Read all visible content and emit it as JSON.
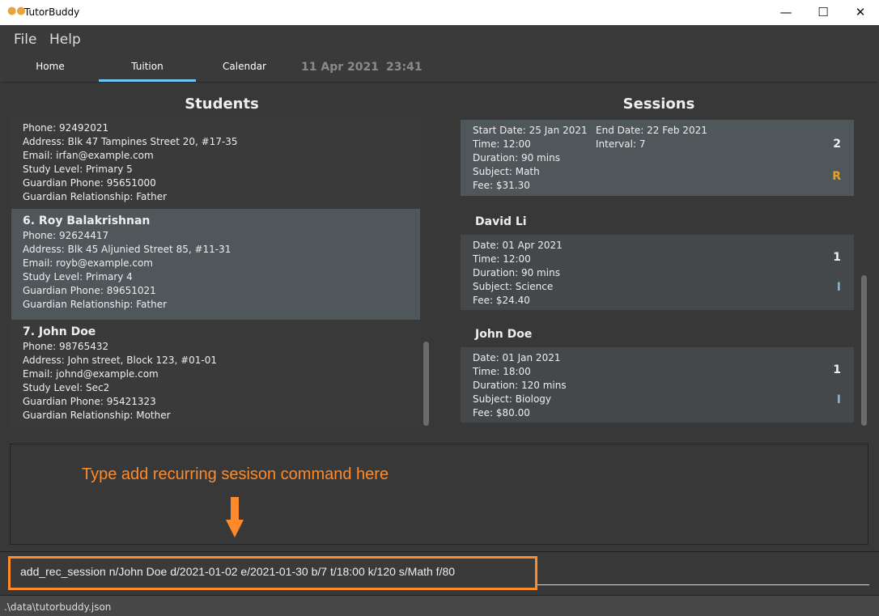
{
  "window": {
    "title": "TutorBuddy",
    "icon": "users-icon",
    "minimize": "—",
    "maximize": "☐",
    "close": "✕"
  },
  "menu": [
    "File",
    "Help"
  ],
  "tabs": [
    {
      "label": "Home"
    },
    {
      "label": "Tuition",
      "active": true
    },
    {
      "label": "Calendar"
    }
  ],
  "clock": {
    "date": "11 Apr 2021",
    "time": "23:41"
  },
  "students": {
    "title": "Students",
    "items": [
      {
        "name": "",
        "lines": [
          "Phone: 92492021",
          "Address: Blk 47 Tampines Street 20, #17-35",
          "Email: irfan@example.com",
          "Study Level: Primary 5",
          "Guardian Phone: 95651000",
          "Guardian Relationship: Father"
        ]
      },
      {
        "name": "6.  Roy Balakrishnan",
        "selected": true,
        "lines": [
          "Phone: 92624417",
          "Address: Blk 45 Aljunied Street 85, #11-31",
          "Email: royb@example.com",
          "Study Level: Primary 4",
          "Guardian Phone: 89651021",
          "Guardian Relationship: Father"
        ]
      },
      {
        "name": "7.  John Doe",
        "lines": [
          "Phone: 98765432",
          "Address: John street, Block 123, #01-01",
          "Email: johnd@example.com",
          "Study Level: Sec2",
          "Guardian Phone: 95421323",
          "Guardian Relationship: Mother"
        ]
      }
    ]
  },
  "sessions": {
    "title": "Sessions",
    "groups": [
      {
        "student": "",
        "sessions": [
          {
            "lines": [
              "Start Date: 25 Jan 2021",
              "Time: 12:00",
              "Duration: 90 mins",
              "Subject: Math",
              "Fee: $31.30"
            ],
            "extra": [
              "End Date: 22 Feb 2021",
              "Interval: 7"
            ],
            "index": "2",
            "type": "R",
            "type_color": "#e8a020"
          }
        ]
      },
      {
        "student": "David Li",
        "sessions": [
          {
            "lines": [
              "Date: 01 Apr 2021",
              "Time: 12:00",
              "Duration: 90 mins",
              "Subject: Science",
              "Fee: $24.40"
            ],
            "index": "1",
            "type": "I",
            "type_color": "#7ab8d8"
          }
        ]
      },
      {
        "student": "John Doe",
        "sessions": [
          {
            "lines": [
              "Date: 01 Jan 2021",
              "Time: 18:00",
              "Duration: 120 mins",
              "Subject: Biology",
              "Fee: $80.00"
            ],
            "index": "1",
            "type": "I",
            "type_color": "#7ab8d8"
          }
        ]
      }
    ]
  },
  "annotation": {
    "text": "Type add recurring sesison command here",
    "color": "#ff8a2a"
  },
  "command": {
    "value": "add_rec_session n/John Doe d/2021-01-02 e/2021-01-30 b/7 t/18:00 k/120 s/Math f/80"
  },
  "status": {
    "path": ".\\data\\tutorbuddy.json"
  }
}
